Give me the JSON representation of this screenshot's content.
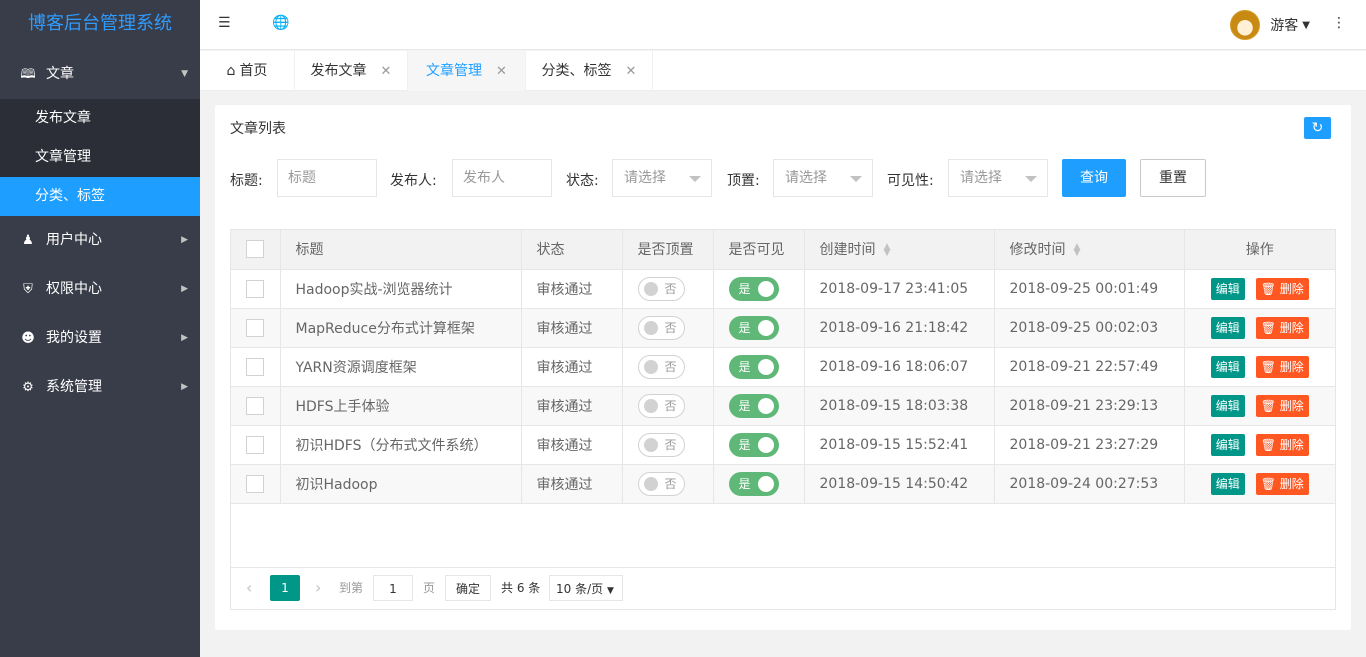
{
  "app": {
    "title": "博客后台管理系统"
  },
  "sidebar": {
    "article": {
      "label": "文章",
      "icon": "book-icon"
    },
    "sub_items": [
      {
        "label": "发布文章"
      },
      {
        "label": "文章管理"
      },
      {
        "label": "分类、标签",
        "active": true
      }
    ],
    "items": [
      {
        "label": "用户中心",
        "icon": "users-icon"
      },
      {
        "label": "权限中心",
        "icon": "shield-icon"
      },
      {
        "label": "我的设置",
        "icon": "user-icon"
      },
      {
        "label": "系统管理",
        "icon": "gear-icon"
      }
    ]
  },
  "header": {
    "user_name": "游客"
  },
  "tabs": [
    {
      "label": "首页"
    },
    {
      "label": "发布文章"
    },
    {
      "label": "文章管理",
      "active": true
    },
    {
      "label": "分类、标签"
    }
  ],
  "card": {
    "title": "文章列表"
  },
  "filters": {
    "title_label": "标题:",
    "title_placeholder": "标题",
    "author_label": "发布人:",
    "author_placeholder": "发布人",
    "status_label": "状态:",
    "status_value": "请选择",
    "top_label": "顶置:",
    "top_value": "请选择",
    "visible_label": "可见性:",
    "visible_value": "请选择",
    "query": "查询",
    "reset": "重置"
  },
  "table": {
    "headers": [
      "标题",
      "状态",
      "是否顶置",
      "是否可见",
      "创建时间",
      "修改时间",
      "操作"
    ],
    "switch_off": "否",
    "switch_on": "是",
    "edit": "编辑",
    "delete": "删除",
    "rows": [
      {
        "title": "Hadoop实战-浏览器统计",
        "status": "审核通过",
        "created": "2018-09-17 23:41:05",
        "modified": "2018-09-25 00:01:49"
      },
      {
        "title": "MapReduce分布式计算框架",
        "status": "审核通过",
        "created": "2018-09-16 21:18:42",
        "modified": "2018-09-25 00:02:03"
      },
      {
        "title": "YARN资源调度框架",
        "status": "审核通过",
        "created": "2018-09-16 18:06:07",
        "modified": "2018-09-21 22:57:49"
      },
      {
        "title": "HDFS上手体验",
        "status": "审核通过",
        "created": "2018-09-15 18:03:38",
        "modified": "2018-09-21 23:29:13"
      },
      {
        "title": "初识HDFS（分布式文件系统）",
        "status": "审核通过",
        "created": "2018-09-15 15:52:41",
        "modified": "2018-09-21 23:27:29"
      },
      {
        "title": "初识Hadoop",
        "status": "审核通过",
        "created": "2018-09-15 14:50:42",
        "modified": "2018-09-24 00:27:53"
      }
    ]
  },
  "pager": {
    "current": "1",
    "goto_label": "到第",
    "goto_value": "1",
    "page_label": "页",
    "confirm": "确定",
    "total": "共 6 条",
    "page_size": "10 条/页"
  },
  "colors": {
    "accent": "#1e9fff",
    "sidebar": "#393d49",
    "teal": "#009688",
    "danger": "#ff5722",
    "switch_on": "#5fb878"
  }
}
